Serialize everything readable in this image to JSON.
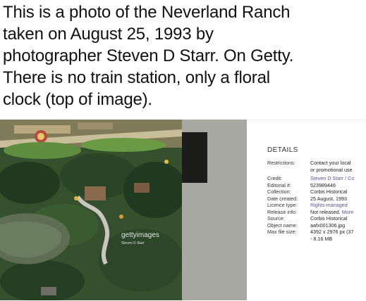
{
  "tweet": {
    "lines": [
      "This is a photo of the Neverland Ranch",
      "taken on August 25, 1993 by",
      "photographer Steven D Starr. On Getty.",
      "There is no train station, only a floral",
      "clock (top of image)."
    ]
  },
  "image": {
    "watermark": "gettyimages",
    "watermark_credit": "Steven D Starr"
  },
  "details": {
    "title": "DETAILS",
    "rows": [
      {
        "key": "Restrictions:",
        "value": "Contact your local",
        "link": "",
        "value2": "or promotional use"
      },
      {
        "key": "Credit:",
        "value": "",
        "link": "Steven D Starr / Co",
        "value2": ""
      },
      {
        "key": "Editorial #:",
        "value": "523989446",
        "link": "",
        "value2": ""
      },
      {
        "key": "Collection:",
        "value": "Corbis Historical",
        "link": "",
        "value2": ""
      },
      {
        "key": "Date created:",
        "value": "25 August, 1993",
        "link": "",
        "value2": ""
      },
      {
        "key": "Licence type:",
        "value": "",
        "link": "Rights-managed",
        "value2": ""
      },
      {
        "key": "Release info:",
        "value": "Not released. ",
        "link": "More",
        "value2": ""
      },
      {
        "key": "Source:",
        "value": "Corbis Historical",
        "link": "",
        "value2": ""
      },
      {
        "key": "Object name:",
        "value": "aafx001306.jpg",
        "link": "",
        "value2": ""
      },
      {
        "key": "Max file size:",
        "value": "4392 x 2976 px (37",
        "link": "",
        "value2": "- 8.16 MB"
      }
    ]
  },
  "colors": {
    "link": "#5b4fb6",
    "text": "#111111",
    "panel_gray": "#a7a8a2"
  }
}
